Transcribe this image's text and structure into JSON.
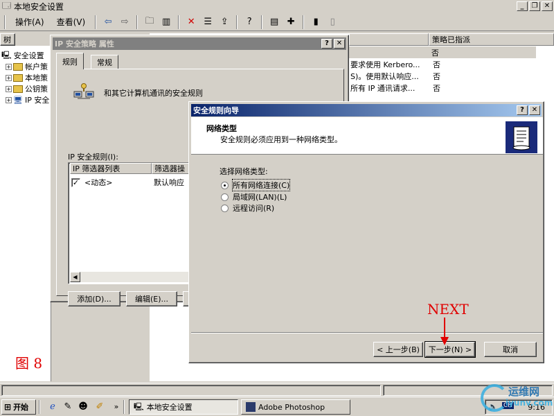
{
  "main_window": {
    "title": "本地安全设置",
    "min": "_",
    "restore": "❐",
    "close": "✕"
  },
  "menu": {
    "action": "操作(A)",
    "view": "查看(V)"
  },
  "tree": {
    "tab_label": "树",
    "items": [
      "安全设置",
      "帐户策",
      "本地策",
      "公钥策",
      "IP 安全"
    ]
  },
  "list": {
    "col2": "策略已指派",
    "rows": [
      {
        "desc": "",
        "assigned": "否"
      },
      {
        "desc": "要求使用 Kerbero...",
        "assigned": "否"
      },
      {
        "desc": "S)。使用默认响应...",
        "assigned": "否"
      },
      {
        "desc": "所有 IP 通讯请求...",
        "assigned": "否"
      }
    ]
  },
  "prop_dialog": {
    "title": "IP 安全策略 属性",
    "help": "?",
    "close": "✕",
    "tabs": [
      "规则",
      "常规"
    ],
    "description": "和其它计算机通讯的安全规则",
    "rules_label": "IP 安全规则(I):",
    "columns": [
      "IP 筛选器列表",
      "筛选器操"
    ],
    "rows": [
      {
        "filter": "<动态>",
        "action": "默认响应"
      }
    ],
    "add_button": "添加(D)...",
    "edit_button": "编辑(E)..."
  },
  "wizard": {
    "title": "安全规则向导",
    "help": "?",
    "close": "✕",
    "heading": "网络类型",
    "subheading": "安全规则必须应用到一种网络类型。",
    "prompt": "选择网络类型:",
    "options": [
      {
        "label": "所有网络连接(C)",
        "selected": true
      },
      {
        "label": "局域网(LAN)(L)",
        "selected": false
      },
      {
        "label": "远程访问(R)",
        "selected": false
      }
    ],
    "back_button": "< 上一步(B)",
    "next_button": "下一步(N) >",
    "cancel_button": "取消"
  },
  "annotations": {
    "next_label": "NEXT",
    "figure_label": "图 8",
    "color": "#e00000"
  },
  "taskbar": {
    "start": "开始",
    "tasks": [
      "本地安全设置",
      "Adobe Photoshop"
    ],
    "lang": "CH",
    "clock": "9:16"
  },
  "watermark": {
    "text": "运维网",
    "sub": "iyunv.com"
  }
}
